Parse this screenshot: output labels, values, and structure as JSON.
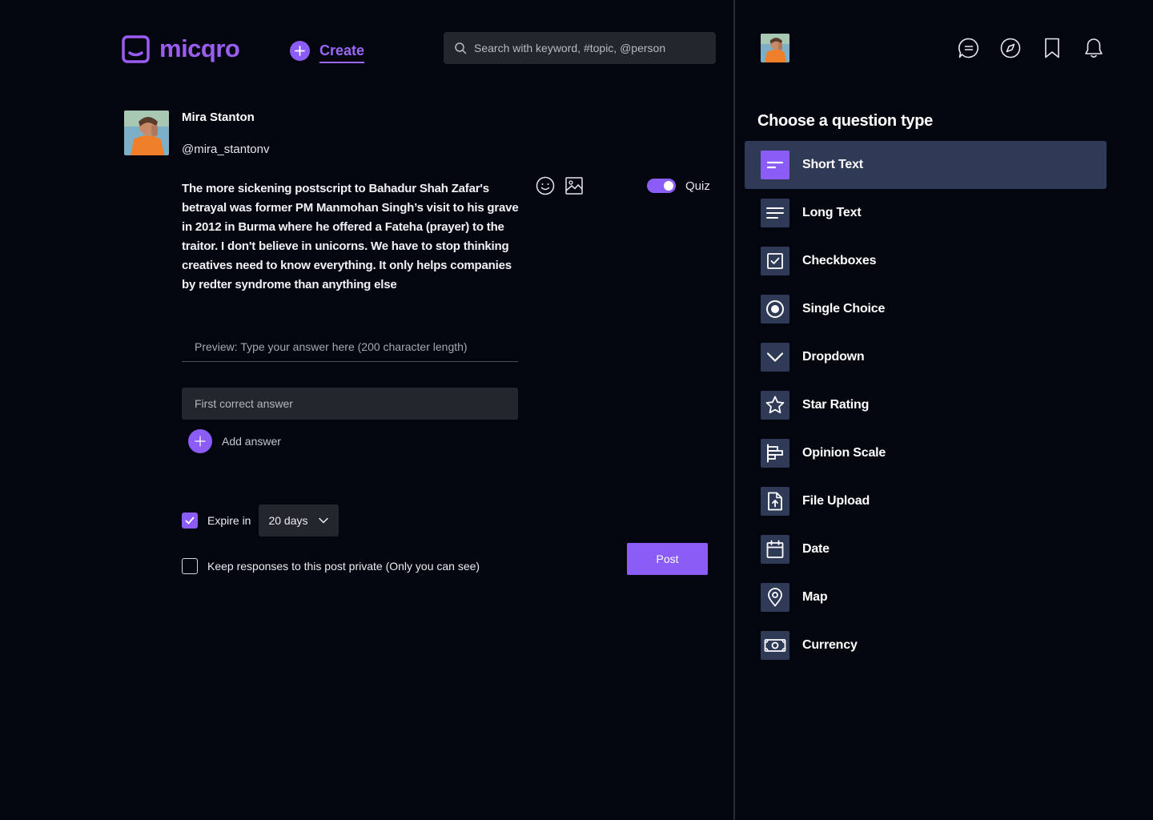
{
  "app": {
    "name": "micqro",
    "create_label": "Create",
    "search_placeholder": "Search with keyword, #topic, @person"
  },
  "composer": {
    "user_name": "Mira Stanton",
    "user_handle": "@mira_stantonv",
    "post_text": "The more sickening postscript to Bahadur Shah Zafar's betrayal was former PM Manmohan Singh’s visit to his grave in 2012 in Burma where he offered a Fateha (prayer) to the traitor. I don't believe in unicorns. We have to stop thinking creatives need to know everything. It only helps companies by redter syndrome than anything else",
    "quiz_label": "Quiz",
    "quiz_enabled": true,
    "preview_placeholder": "Preview: Type your answer here (200 character length)",
    "answer_placeholder": "First correct answer",
    "add_answer_label": "Add answer",
    "expire_label": "Expire in",
    "expire_checked": true,
    "expire_value": "20 days",
    "private_label": "Keep responses to this post private (Only you can see)",
    "private_checked": false,
    "post_button": "Post"
  },
  "right_panel": {
    "nav_icons": [
      "chat-icon",
      "compass-icon",
      "bookmark-icon",
      "bell-icon"
    ],
    "title": "Choose  a question type",
    "question_types": [
      {
        "label": "Short Text",
        "icon": "short-text-icon",
        "selected": true
      },
      {
        "label": "Long Text",
        "icon": "long-text-icon",
        "selected": false
      },
      {
        "label": "Checkboxes",
        "icon": "checkbox-icon",
        "selected": false
      },
      {
        "label": "Single Choice",
        "icon": "radio-icon",
        "selected": false
      },
      {
        "label": "Dropdown",
        "icon": "chevron-down-icon",
        "selected": false
      },
      {
        "label": "Star Rating",
        "icon": "star-icon",
        "selected": false
      },
      {
        "label": "Opinion Scale",
        "icon": "scale-icon",
        "selected": false
      },
      {
        "label": "File Upload",
        "icon": "file-upload-icon",
        "selected": false
      },
      {
        "label": "Date",
        "icon": "calendar-icon",
        "selected": false
      },
      {
        "label": "Map",
        "icon": "map-pin-icon",
        "selected": false
      },
      {
        "label": "Currency",
        "icon": "banknote-icon",
        "selected": false
      }
    ]
  },
  "colors": {
    "background": "#04060f",
    "accent": "#8b5cf6",
    "panel_selected": "#2f3a57",
    "input_bg": "#24262e"
  }
}
